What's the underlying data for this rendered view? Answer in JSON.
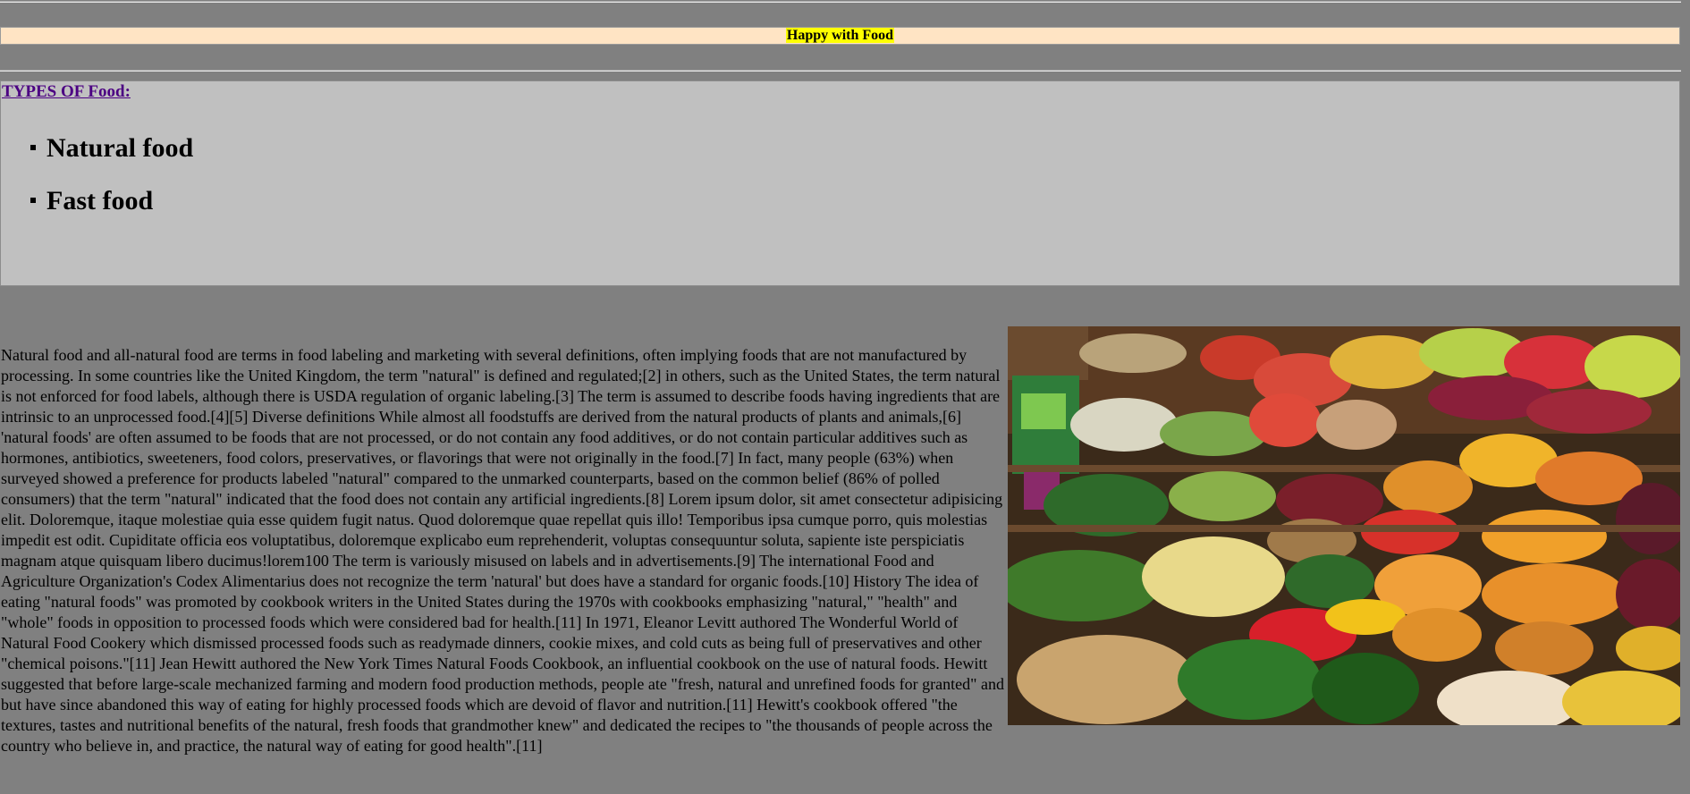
{
  "header": {
    "title": "Happy with Food"
  },
  "types": {
    "heading": "TYPES OF Food:",
    "items": [
      {
        "label": "Natural food"
      },
      {
        "label": "Fast food"
      }
    ]
  },
  "photo": {
    "subject": "market stall with fresh fruits and vegetables"
  },
  "article": {
    "body": "Natural food and all-natural food are terms in food labeling and marketing with several definitions, often implying foods that are not manufactured by processing. In some countries like the United Kingdom, the term \"natural\" is defined and regulated;[2] in others, such as the United States, the term natural is not enforced for food labels, although there is USDA regulation of organic labeling.[3] The term is assumed to describe foods having ingredients that are intrinsic to an unprocessed food.[4][5] Diverse definitions While almost all foodstuffs are derived from the natural products of plants and animals,[6] 'natural foods' are often assumed to be foods that are not processed, or do not contain any food additives, or do not contain particular additives such as hormones, antibiotics, sweeteners, food colors, preservatives, or flavorings that were not originally in the food.[7] In fact, many people (63%) when surveyed showed a preference for products labeled \"natural\" compared to the unmarked counterparts, based on the common belief (86% of polled consumers) that the term \"natural\" indicated that the food does not contain any artificial ingredients.[8] Lorem ipsum dolor, sit amet consectetur adipisicing elit. Doloremque, itaque molestiae quia esse quidem fugit natus. Quod doloremque quae repellat quis illo! Temporibus ipsa cumque porro, quis molestias impedit est odit. Cupiditate officia eos voluptatibus, doloremque explicabo eum reprehenderit, voluptas consequuntur soluta, sapiente iste perspiciatis magnam atque quisquam libero ducimus!lorem100 The term is variously misused on labels and in advertisements.[9] The international Food and Agriculture Organization's Codex Alimentarius does not recognize the term 'natural' but does have a standard for organic foods.[10] History The idea of eating \"natural foods\" was promoted by cookbook writers in the United States during the 1970s with cookbooks emphasizing \"natural,\" \"health\" and \"whole\" foods in opposition to processed foods which were considered bad for health.[11] In 1971, Eleanor Levitt authored The Wonderful World of Natural Food Cookery which dismissed processed foods such as readymade dinners, cookie mixes, and cold cuts as being full of preservatives and other \"chemical poisons.\"[11] Jean Hewitt authored the New York Times Natural Foods Cookbook, an influential cookbook on the use of natural foods. Hewitt suggested that before large-scale mechanized farming and modern food production methods, people ate \"fresh, natural and unrefined foods for granted\" and but have since abandoned this way of eating for highly processed foods which are devoid of flavor and nutrition.[11] Hewitt's cookbook offered \"the textures, tastes and nutritional benefits of the natural, fresh foods that grandmother knew\" and dedicated the recipes to \"the thousands of people across the country who believe in, and practice, the natural way of eating for good health\".[11]"
  },
  "colors": {
    "page_background": "#808080",
    "header_background": "#ffe4c4",
    "title_highlight": "#ffff00",
    "types_box_background": "#c0c0c0",
    "link_color": "#4b0082"
  }
}
